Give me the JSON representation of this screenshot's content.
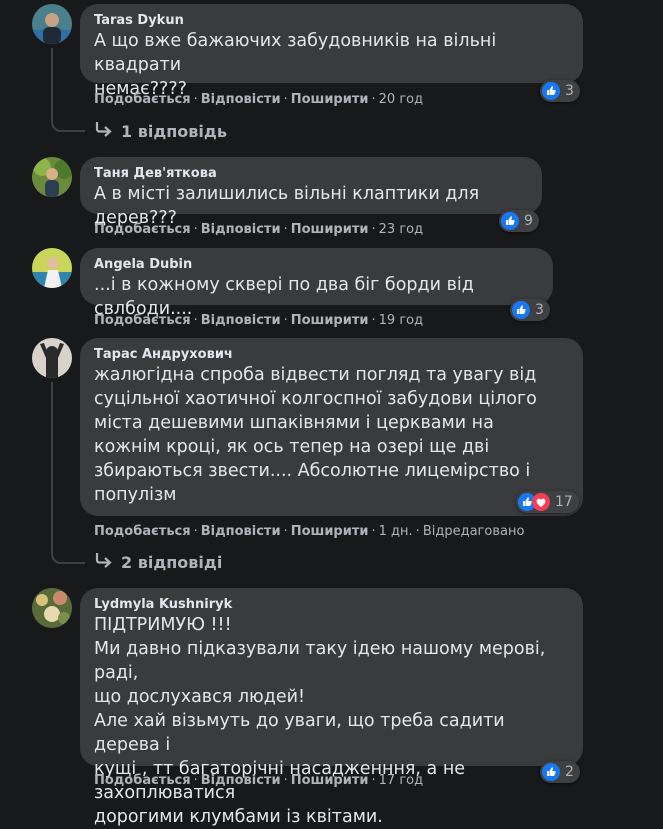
{
  "actions": {
    "like": "Подобається",
    "reply": "Відповісти",
    "share": "Поширити",
    "separator": "·"
  },
  "comments": [
    {
      "author": "Taras Dykun",
      "text": "А що вже бажаючих забудовників на вільні квадрати\nнемає????",
      "time": "20 год",
      "reaction_count": "3",
      "replies": "1 відповідь"
    },
    {
      "author": "Таня Дев'яткова",
      "text": "А в місті залишились вільні клаптики для дерев???",
      "time": "23 год",
      "reaction_count": "9"
    },
    {
      "author": "Angela Dubin",
      "text": "...і в кожному сквері по два біг борди від свлбоди....",
      "time": "19 год",
      "reaction_count": "3"
    },
    {
      "author": "Тарас Андрухович",
      "text": "жалюгідна спроба відвести погляд та увагу від\nсуцільної хаотичної колгоспної забудови цілого\nміста дешевими шпаківнями і церквами на\nкожнім кроці, як ось тепер на озері ще дві\nзбираються звести.... Абсолютне лицемірство і\nпопулізм",
      "time": "1 дн.",
      "edited": "Відредаговано",
      "reaction_count": "17",
      "replies": "2 відповіді"
    },
    {
      "author": "Lydmyla Kushniryk",
      "text": "ПІДТРИМУЮ !!!\nМи давно підказували таку ідею нашому мерові, раді,\nщо дослухався людей!\nАле хай візьмуть до уваги, що треба садити дерева і\nкущі , тт багаторічні насадженння, а не захоплюватися\nдорогими клумбами із квітами.",
      "time": "17 год",
      "reaction_count": "2"
    }
  ],
  "colors": {
    "background": "#18191a",
    "bubble": "#3a3b3c",
    "like_blue": "#1877f2",
    "love_red": "#f33e58",
    "secondary_text": "#b0b3b8"
  },
  "icons": {
    "like": "thumbs-up-icon",
    "love": "heart-icon",
    "reply_arrow": "reply-arrow-icon"
  }
}
